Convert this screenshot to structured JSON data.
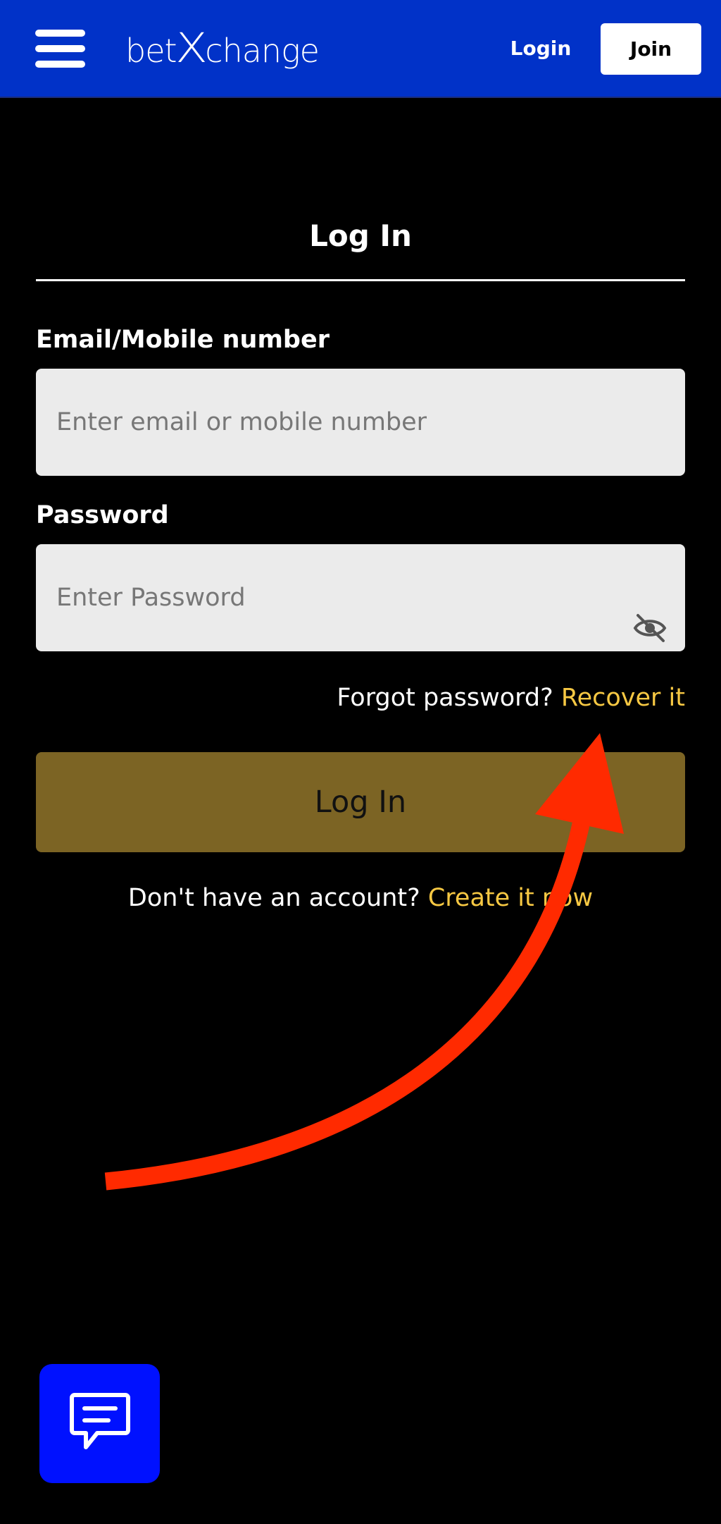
{
  "header": {
    "logo_left": "bet",
    "logo_x": "X",
    "logo_right": "change",
    "login_label": "Login",
    "join_label": "Join",
    "background_color": "#0132c8"
  },
  "form": {
    "title": "Log In",
    "email": {
      "label": "Email/Mobile number",
      "placeholder": "Enter email or mobile number",
      "value": ""
    },
    "password": {
      "label": "Password",
      "placeholder": "Enter Password",
      "value": "",
      "visibility_icon": "eye-off-icon"
    },
    "forgot": {
      "prompt": "Forgot password?",
      "link": "Recover it"
    },
    "submit_label": "Log In",
    "signup": {
      "prompt": "Don't have an account?",
      "link": "Create it now"
    }
  },
  "chat": {
    "icon": "chat-bubble-icon"
  },
  "colors": {
    "accent_link": "#f7c843",
    "submit_button": "#7c6424",
    "chat_button": "#0011ff",
    "annotation_arrow": "#ff2a00"
  }
}
